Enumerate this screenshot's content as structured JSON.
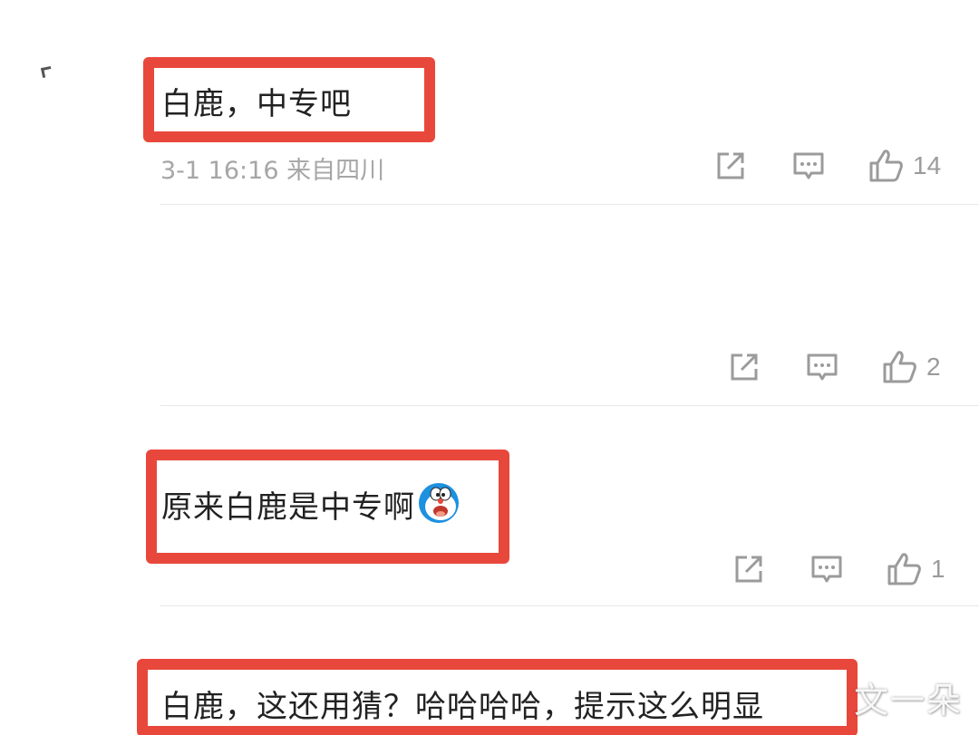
{
  "colors": {
    "highlight": "#e8483b",
    "text": "#222222",
    "meta": "#a6a6a6",
    "icon": "#9b9b9b"
  },
  "comments": [
    {
      "text": "白鹿，中专吧",
      "meta": "3-1 16:16  来自四川",
      "likes": "14"
    },
    {
      "text": "",
      "likes": "2"
    },
    {
      "text": "原来白鹿是中专啊",
      "emoji": "doraemon-face",
      "likes": "1"
    },
    {
      "text": "白鹿，这还用猜？哈哈哈哈，提示这么明显"
    }
  ],
  "watermark": "文一朵",
  "icons": {
    "share": "share-icon",
    "reply": "comment-icon",
    "like": "thumbs-up-icon"
  }
}
